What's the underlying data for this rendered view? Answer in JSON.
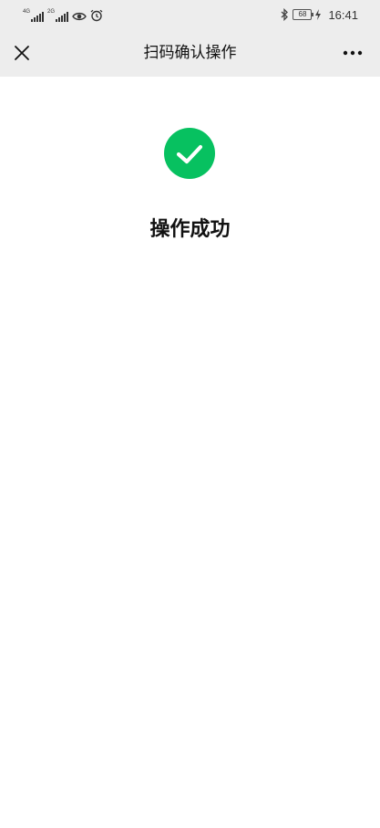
{
  "status_bar": {
    "net1_label": "4G",
    "net2_label": "2G",
    "battery_level": "68",
    "time": "16:41",
    "icons": [
      "signal-icon",
      "signal-icon",
      "eye-icon",
      "alarm-icon",
      "bluetooth-icon",
      "battery-icon",
      "charging-icon"
    ]
  },
  "nav": {
    "title": "扫码确认操作",
    "close_icon": "close-icon",
    "more_icon": "more-icon"
  },
  "result": {
    "icon": "success-check-icon",
    "icon_color": "#07c160",
    "title": "操作成功"
  },
  "colors": {
    "header_bg": "#ededed",
    "body_bg": "#ffffff",
    "accent": "#07c160"
  }
}
